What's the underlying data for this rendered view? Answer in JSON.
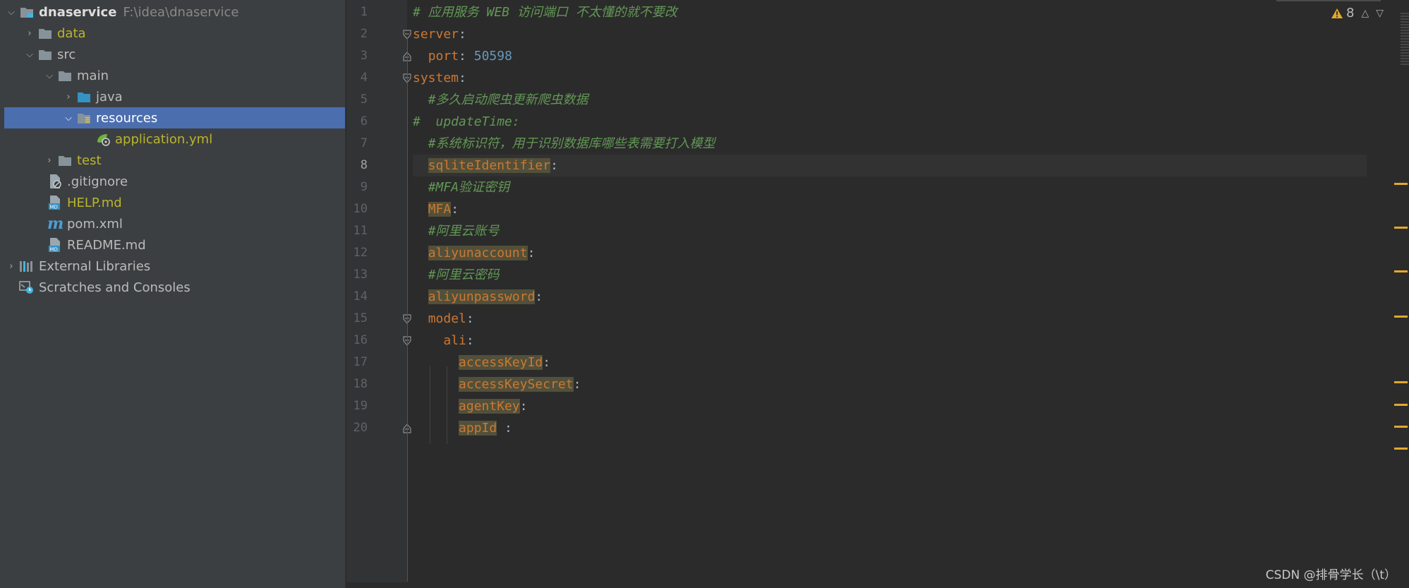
{
  "project_tree": {
    "rows": [
      {
        "label": "dnaservice",
        "extra": "F:\\idea\\dnaservice",
        "expanded": true
      },
      {
        "label": "data",
        "expanded": false
      },
      {
        "label": "src",
        "expanded": true
      },
      {
        "label": "main",
        "expanded": true
      },
      {
        "label": "java",
        "expanded": false
      },
      {
        "label": "resources",
        "expanded": true,
        "selected": true
      },
      {
        "label": "application.yml"
      },
      {
        "label": "test",
        "expanded": false
      },
      {
        "label": ".gitignore"
      },
      {
        "label": "HELP.md"
      },
      {
        "label": "pom.xml"
      },
      {
        "label": "README.md"
      },
      {
        "label": "External Libraries",
        "expanded": false
      },
      {
        "label": "Scratches and Consoles"
      }
    ]
  },
  "editor": {
    "line_numbers": [
      "1",
      "2",
      "3",
      "4",
      "5",
      "6",
      "7",
      "8",
      "9",
      "10",
      "11",
      "12",
      "13",
      "14",
      "15",
      "16",
      "17",
      "18",
      "19",
      "20"
    ],
    "current_line": 8,
    "lines": {
      "l1": {
        "comment": "# 应用服务 WEB 访问端口 不太懂的就不要改"
      },
      "l2": {
        "key": "server",
        "colon": ":"
      },
      "l3": {
        "key": "port",
        "colon": ":",
        "value": "50598"
      },
      "l4": {
        "key": "system",
        "colon": ":"
      },
      "l5": {
        "comment": "#多久启动爬虫更新爬虫数据"
      },
      "l6": {
        "comment": "#  updateTime:"
      },
      "l7": {
        "comment": "#系统标识符，用于识别数据库哪些表需要打入模型"
      },
      "l8": {
        "key": "sqliteIdentifier",
        "colon": ":"
      },
      "l9": {
        "comment": "#MFA验证密钥"
      },
      "l10": {
        "key": "MFA",
        "colon": ":"
      },
      "l11": {
        "comment": "#阿里云账号"
      },
      "l12": {
        "key": "aliyunaccount",
        "colon": ":"
      },
      "l13": {
        "comment": "#阿里云密码"
      },
      "l14": {
        "key": "aliyunpassword",
        "colon": ":"
      },
      "l15": {
        "key": "model",
        "colon": ":"
      },
      "l16": {
        "key": "ali",
        "colon": ":"
      },
      "l17": {
        "key": "accessKeyId",
        "colon": ":"
      },
      "l18": {
        "key": "accessKeySecret",
        "colon": ":"
      },
      "l19": {
        "key": "agentKey",
        "colon": ":"
      },
      "l20": {
        "key": "appId",
        "colon": " :"
      }
    },
    "inspection": {
      "warning_count": "8",
      "icon": "warning-triangle-icon"
    },
    "watermark": "CSDN @排骨学长（\\t）"
  },
  "colors": {
    "tree_bg": "#3c3f41",
    "editor_bg": "#2b2b2b",
    "selection": "#4b6eaf",
    "keyword": "#cc7832",
    "comment": "#629755",
    "number": "#6897bb",
    "warning_highlight": "#52503a",
    "warning_stripe": "#e0a82e"
  }
}
